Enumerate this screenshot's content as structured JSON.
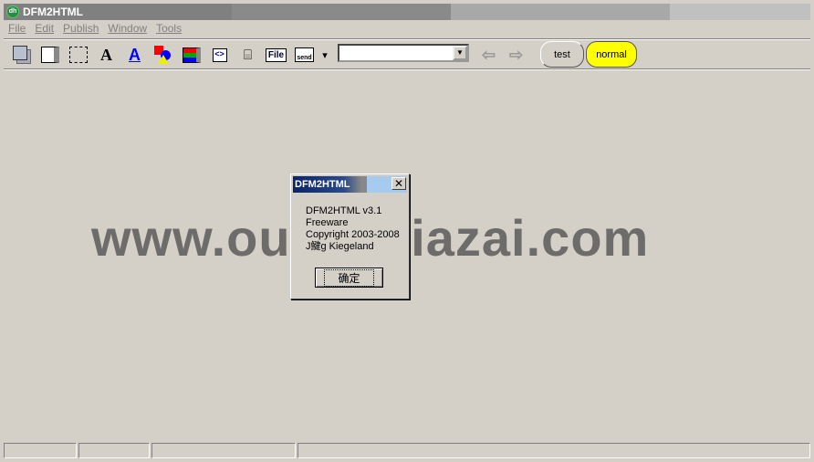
{
  "window": {
    "title": "DFM2HTML"
  },
  "menu": [
    "File",
    "Edit",
    "Publish",
    "Window",
    "Tools"
  ],
  "toolbar": {
    "icons": [
      "bring-to-front-icon",
      "panel-icon",
      "selection-frame-icon",
      "text-icon",
      "hyperlink-text-icon",
      "shapes-icon",
      "colored-list-icon",
      "html-code-icon",
      "pointer-form-icon",
      "file-icon",
      "send-form-icon"
    ],
    "file_label": "File",
    "send_label": "send",
    "combo_value": "",
    "back": "back-arrow-icon",
    "forward": "forward-arrow-icon",
    "test_label": "test",
    "normal_label": "normal",
    "normal_color": "#ffff00"
  },
  "watermark": "www.ouyaoxiazai.com",
  "dialog": {
    "title": "DFM2HTML",
    "lines": [
      "DFM2HTML v3.1",
      "Freeware",
      "Copyright 2003-2008",
      "J鰎g Kiegeland"
    ],
    "ok": "确定"
  },
  "statusbar": [
    "",
    "",
    "",
    "",
    ""
  ]
}
